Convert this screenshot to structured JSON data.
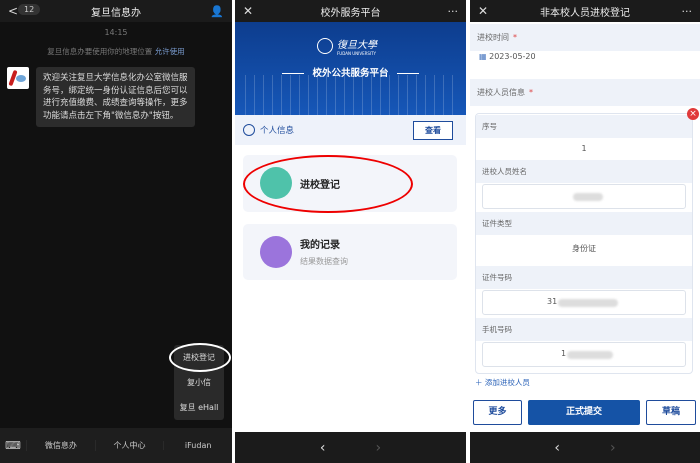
{
  "wechat": {
    "back": "<",
    "unread": "12",
    "title": "复旦信息办",
    "profile_icon": "person-icon",
    "time": "14:15",
    "notice": "复旦信息办要使用你的地理位置",
    "notice_link": "允许使用",
    "message": "欢迎关注复旦大学信息化办公室微信服务号，绑定统一身份认证信息后您可以进行充值缴费、成绩查询等操作，更多功能请点击左下角\"微信息办\"按钮。",
    "popup_menu": [
      "进校登记",
      "复小信",
      "复旦 eHall"
    ],
    "bottom_menu": [
      "微信息办",
      "个人中心",
      "iFudan"
    ]
  },
  "platform": {
    "title": "校外服务平台",
    "univ_name": "復旦大學",
    "univ_en": "FUDAN UNIVERSITY",
    "banner_title": "校外公共服务平台",
    "personal_info": "个人信息",
    "view_button": "查看",
    "cards": [
      {
        "title": "进校登记",
        "subtitle": ""
      },
      {
        "title": "我的记录",
        "subtitle": "结果数据查询"
      }
    ]
  },
  "form": {
    "title": "非本校人员进校登记",
    "entry_time_label": "进校时间",
    "entry_date": "2023-05-20",
    "visitor_info_label": "进校人员信息",
    "seq_label": "序号",
    "seq_value": "1",
    "name_label": "进校人员姓名",
    "id_type_label": "证件类型",
    "id_type_value": "身份证",
    "id_no_label": "证件号码",
    "id_no_prefix": "31",
    "phone_label": "手机号码",
    "phone_prefix": "1",
    "add_visitor": "添加进校人员",
    "more_button": "更多",
    "submit_button": "正式提交",
    "draft_button": "草稿"
  },
  "nav": {
    "back": "‹",
    "forward": "›",
    "close": "✕",
    "more": "···"
  }
}
